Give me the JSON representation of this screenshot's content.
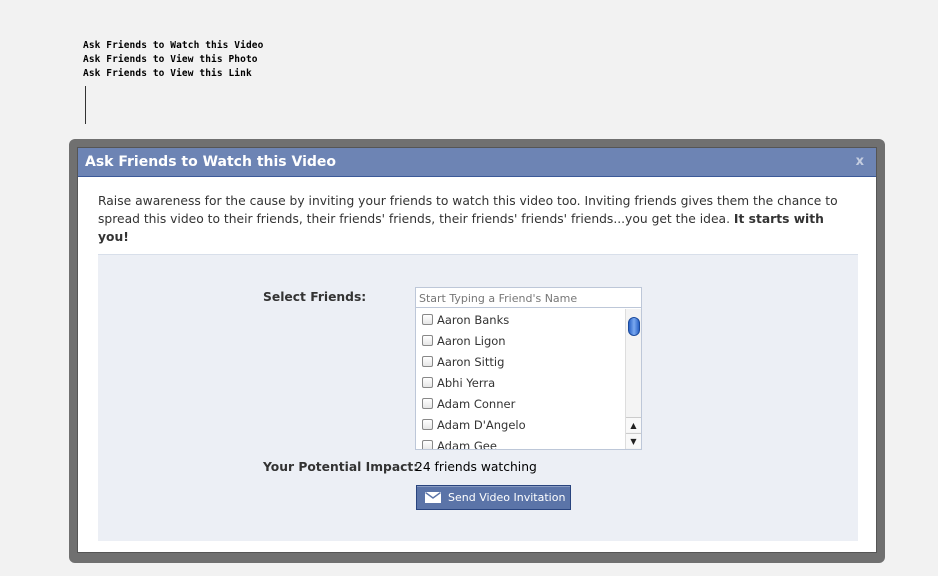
{
  "ask_links": [
    "Ask Friends to Watch this Video",
    "Ask Friends to View this Photo",
    "Ask Friends to View this Link"
  ],
  "dialog": {
    "title": "Ask Friends to Watch this Video",
    "close_label": "x",
    "intro_text": "Raise awareness for the cause by inviting your friends to watch this video too. Inviting friends gives them the chance to spread this video to their friends, their friends' friends, their friends' friends' friends...you get the idea.",
    "intro_bold": "It starts with you!",
    "select_label": "Select Friends:",
    "search_placeholder": "Start Typing a Friend's Name",
    "friends": [
      "Aaron Banks",
      "Aaron Ligon",
      "Aaron Sittig",
      "Abhi Yerra",
      "Adam Conner",
      "Adam D'Angelo",
      "Adam Gee"
    ],
    "impact_label": "Your Potential Impact:",
    "impact_value": "24 friends watching",
    "send_button": "Send Video Invitation",
    "icons": {
      "mail": "mail-icon",
      "scroll_up": "arrow-up-icon",
      "scroll_down": "arrow-down-icon"
    },
    "colors": {
      "header": "#6d84b4",
      "button": "#5b74a8",
      "panel": "#eceff5"
    }
  }
}
